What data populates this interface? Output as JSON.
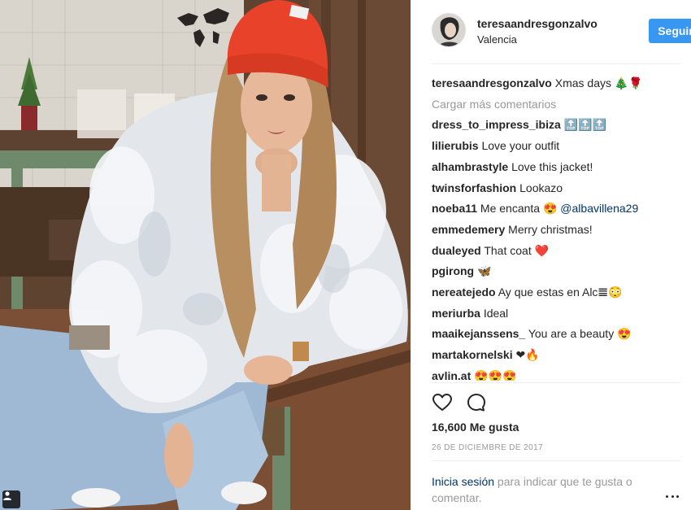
{
  "post": {
    "photo_alt": "",
    "tag_icon": "person-tag-icon"
  },
  "header": {
    "username": "teresaandresgonzalvo",
    "location": "Valencia",
    "follow_label": "Seguir"
  },
  "caption": {
    "username": "teresaandresgonzalvo",
    "text": "Xmas days 🎄🌹"
  },
  "load_more_label": "Cargar más comentarios",
  "comments": [
    {
      "user": "dress_to_impress_ibiza",
      "text": "🔝🔝🔝",
      "mention": ""
    },
    {
      "user": "lilierubis",
      "text": "Love your outfit",
      "mention": ""
    },
    {
      "user": "alhambrastyle",
      "text": "Love this jacket!",
      "mention": ""
    },
    {
      "user": "twinsforfashion",
      "text": "Lookazo",
      "mention": ""
    },
    {
      "user": "noeba11",
      "text": "Me encanta 😍",
      "mention": "@albavillena29"
    },
    {
      "user": "emmedemery",
      "text": "Merry christmas!",
      "mention": ""
    },
    {
      "user": "dualeyed",
      "text": "That coat ❤️",
      "mention": ""
    },
    {
      "user": "pgirong",
      "text": "🦋",
      "mention": ""
    },
    {
      "user": "nereatejedo",
      "text": "Ay que estas en Alc𝌆😳",
      "mention": ""
    },
    {
      "user": "meriurba",
      "text": "Ideal",
      "mention": ""
    },
    {
      "user": "maaikejanssens_",
      "text": "You are a beauty 😍",
      "mention": ""
    },
    {
      "user": "martakornelski",
      "text": "❤🔥",
      "mention": ""
    },
    {
      "user": "avlin.at",
      "text": "😍😍😍",
      "mention": ""
    }
  ],
  "actions": {
    "like_icon": "heart-icon",
    "comment_icon": "comment-bubble-icon"
  },
  "likes_label": "16,600 Me gusta",
  "date_label": "26 de diciembre de 2017",
  "footer": {
    "login_link": "Inicia sesión",
    "login_rest": " para indicar que te gusta o comentar."
  },
  "colors": {
    "accent": "#3897f0",
    "link": "#003569",
    "muted": "#999999",
    "hat": "#e8432a"
  }
}
